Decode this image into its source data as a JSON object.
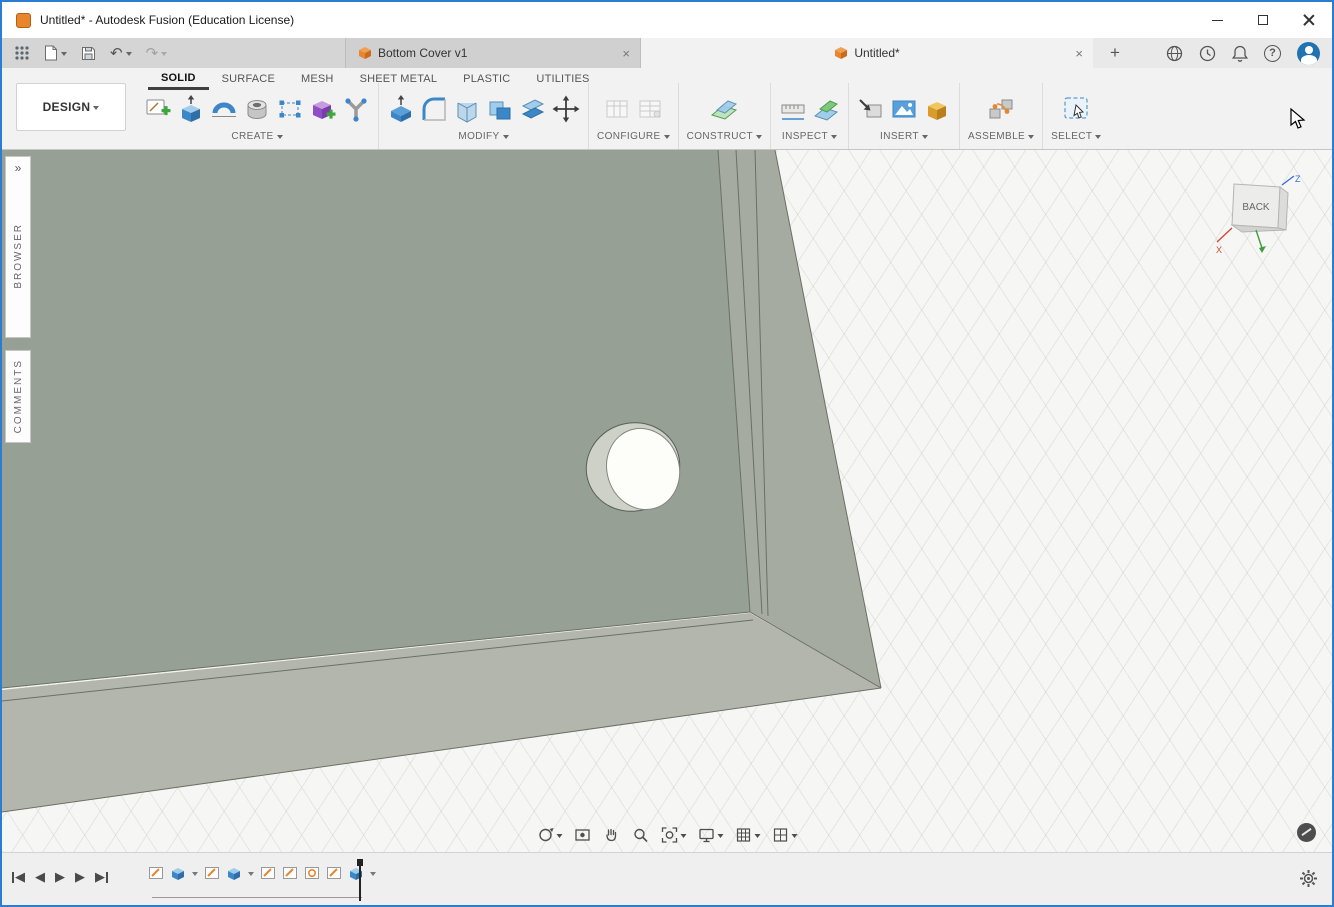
{
  "window": {
    "title": "Untitled* - Autodesk Fusion (Education License)"
  },
  "icons": {
    "undo": "↶",
    "redo": "↷",
    "plus": "+",
    "help_q": "?",
    "close_x": "×",
    "tri_left": "◀",
    "tri_right": "▶",
    "expand": "»"
  },
  "tabs": [
    {
      "title": "Bottom Cover v1"
    },
    {
      "title": "Untitled*"
    }
  ],
  "ribbon": {
    "workspace_label": "DESIGN",
    "active_tab": "SOLID",
    "tabs": [
      {
        "label": "SOLID"
      },
      {
        "label": "SURFACE"
      },
      {
        "label": "MESH"
      },
      {
        "label": "SHEET METAL"
      },
      {
        "label": "PLASTIC"
      },
      {
        "label": "UTILITIES"
      }
    ],
    "groups": [
      {
        "label": "CREATE"
      },
      {
        "label": "MODIFY"
      },
      {
        "label": "CONFIGURE"
      },
      {
        "label": "CONSTRUCT"
      },
      {
        "label": "INSPECT"
      },
      {
        "label": "INSERT"
      },
      {
        "label": "ASSEMBLE"
      },
      {
        "label": "SELECT"
      }
    ]
  },
  "panels": {
    "browser_label": "BROWSER",
    "comments_label": "COMMENTS"
  },
  "viewcube": {
    "face_label": "BACK",
    "axis_x": "X",
    "axis_z": "Z"
  },
  "colors": {
    "window_border": "#2b7cd3",
    "model_face": "#97a094",
    "model_wall_right": "#a6aba1",
    "model_wall_bottom": "#b3b6ad",
    "accent_orange": "#e8862e",
    "accent_blue": "#3b87c8"
  }
}
